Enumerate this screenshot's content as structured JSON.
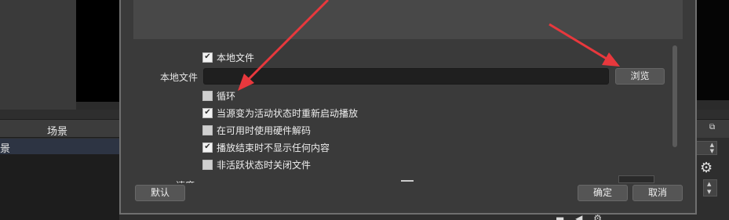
{
  "background": {
    "scene_header": "场景",
    "scene_item": "景",
    "dock_icon": "⧉"
  },
  "dialog": {
    "local_file_checkbox_label": "本地文件",
    "local_file_label": "本地文件",
    "local_file_value": "",
    "browse_label": "浏览",
    "checkboxes": [
      {
        "label": "循环",
        "checked": false
      },
      {
        "label": "当源变为活动状态时重新启动播放",
        "checked": true
      },
      {
        "label": "在可用时使用硬件解码",
        "checked": false
      },
      {
        "label": "播放结束时不显示任何内容",
        "checked": true
      },
      {
        "label": "非活跃状态时关闭文件",
        "checked": false
      }
    ],
    "cut_off_label": "速度",
    "default_label": "默认",
    "ok_label": "确定",
    "cancel_label": "取消"
  },
  "colors": {
    "arrow": "#e8383d",
    "dialog_bg": "#3a3a3a",
    "input_bg": "#1f1f1f"
  }
}
